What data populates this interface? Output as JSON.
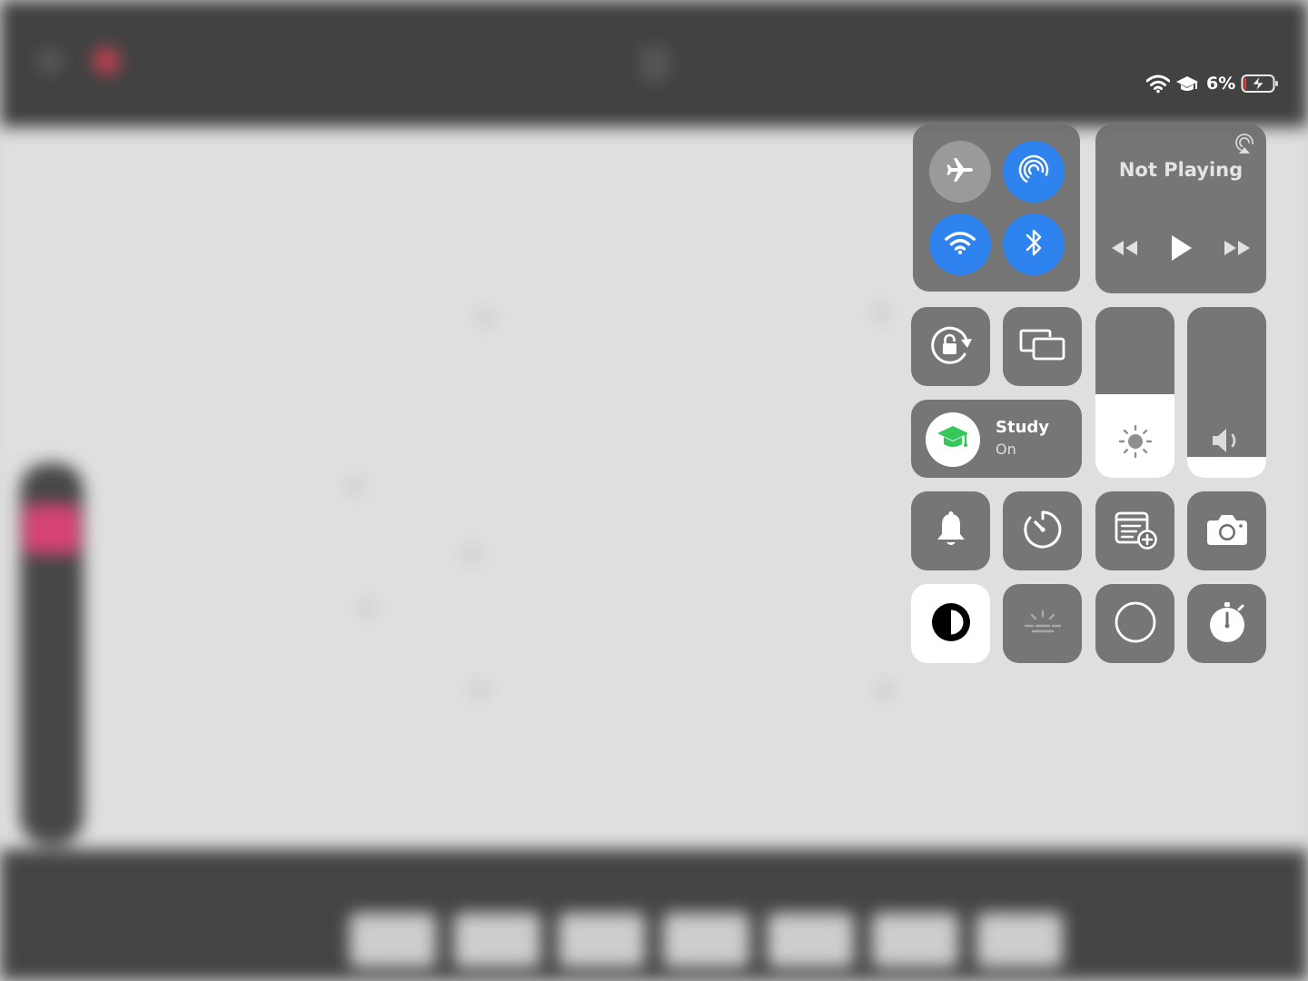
{
  "status_bar": {
    "battery_percent": "6%",
    "battery_level": 0.06,
    "icons": [
      "wifi-icon",
      "study-focus-icon",
      "battery-charging-icon"
    ]
  },
  "connectivity": {
    "airplane": {
      "icon": "airplane-icon",
      "active": false
    },
    "airdrop": {
      "icon": "airdrop-icon",
      "active": true
    },
    "wifi": {
      "icon": "wifi-icon",
      "active": true
    },
    "bluetooth": {
      "icon": "bluetooth-icon",
      "active": true
    }
  },
  "now_playing": {
    "title": "Not Playing",
    "icons": [
      "airplay-icon",
      "rewind-icon",
      "play-icon",
      "fast-forward-icon"
    ]
  },
  "focus": {
    "name": "Study",
    "state": "On",
    "icon": "graduation-cap-icon"
  },
  "sliders": {
    "brightness": {
      "icon": "sun-icon",
      "level": 0.49
    },
    "volume": {
      "icon": "speaker-icon",
      "level": 0.12
    }
  },
  "controls": [
    "orientation-lock-icon",
    "screen-mirroring-icon",
    "bell-icon",
    "timer-icon",
    "quick-note-icon",
    "camera-icon",
    "dark-mode-icon",
    "true-tone-icon",
    "screen-record-icon",
    "stopwatch-icon"
  ],
  "colors": {
    "accent_blue": "#2f83ee",
    "tile_gray": "#6e6e6e",
    "focus_green": "#34c759",
    "battery_low": "#ff3b30"
  }
}
